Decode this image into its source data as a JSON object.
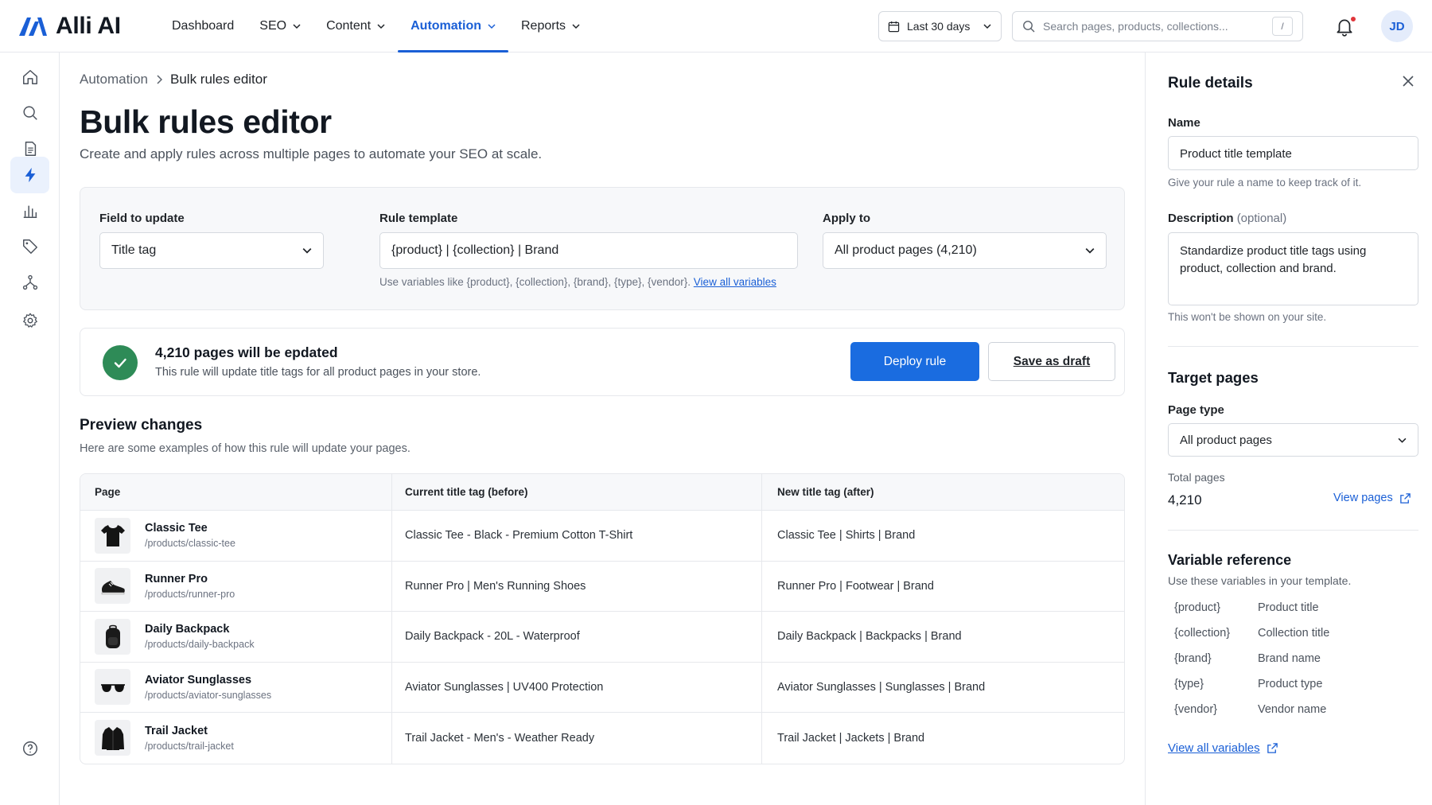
{
  "app": {
    "name": "Alli AI",
    "brand_color": "#1a5fd6"
  },
  "nav": [
    {
      "label": "Dashboard",
      "has_menu": false,
      "active": false
    },
    {
      "label": "SEO",
      "has_menu": true,
      "active": false
    },
    {
      "label": "Content",
      "has_menu": true,
      "active": false
    },
    {
      "label": "Automation",
      "has_menu": true,
      "active": true
    },
    {
      "label": "Reports",
      "has_menu": true,
      "active": false
    }
  ],
  "toolbar": {
    "date_range": "Last 30 days",
    "search_placeholder": "Search pages, products, collections...",
    "search_shortcut": "/",
    "avatar_initials": "JD"
  },
  "rail": [
    "home-icon",
    "search-icon",
    "document-icon",
    "lightning-icon",
    "bar-chart-icon",
    "tag-icon",
    "network-icon",
    "gear-icon",
    "help-icon"
  ],
  "breadcrumb": {
    "parent": "Automation",
    "current": "Bulk rules editor"
  },
  "page": {
    "title": "Bulk rules editor",
    "subtitle": "Create and apply rules across multiple pages to automate your SEO at scale."
  },
  "rule": {
    "field_label": "Field to update",
    "field_value": "Title tag",
    "template_label": "Rule template",
    "template_value": "{product} | {collection} | Brand",
    "template_hint": "Use variables like {product}, {collection}, {brand}, {type}, {vendor}.",
    "template_hint_link": "View all variables",
    "apply_label": "Apply to",
    "apply_value": "All product pages (4,210)"
  },
  "status": {
    "title": "4,210 pages will be epdated",
    "subtitle": "This rule will update title tags for all product pages in your store.",
    "deploy_label": "Deploy rule",
    "draft_label": "Save as draft",
    "status_color": "#2e8b57"
  },
  "preview": {
    "title": "Preview changes",
    "subtitle": "Here are some examples of how this rule will update your pages.",
    "columns": [
      "Page",
      "Current title tag (before)",
      "New title tag (after)"
    ],
    "rows": [
      {
        "name": "Classic Tee",
        "path": "/products/classic-tee",
        "before": "Classic Tee - Black - Premium Cotton T-Shirt",
        "after": "Classic Tee | Shirts | Brand",
        "thumb": "tshirt-icon"
      },
      {
        "name": "Runner Pro",
        "path": "/products/runner-pro",
        "before": "Runner Pro | Men's Running Shoes",
        "after": "Runner Pro | Footwear | Brand",
        "thumb": "shoe-icon"
      },
      {
        "name": "Daily Backpack",
        "path": "/products/daily-backpack",
        "before": "Daily Backpack - 20L - Waterproof",
        "after": "Daily Backpack | Backpacks | Brand",
        "thumb": "backpack-icon"
      },
      {
        "name": "Aviator Sunglasses",
        "path": "/products/aviator-sunglasses",
        "before": "Aviator Sunglasses | UV400 Protection",
        "after": "Aviator Sunglasses | Sunglasses | Brand",
        "thumb": "sunglasses-icon"
      },
      {
        "name": "Trail Jacket",
        "path": "/products/trail-jacket",
        "before": "Trail Jacket - Men's - Weather Ready",
        "after": "Trail Jacket | Jackets | Brand",
        "thumb": "jacket-icon"
      }
    ]
  },
  "panel": {
    "title": "Rule details",
    "name_label": "Name",
    "name_value": "Product title template",
    "name_hint": "Give your rule a name to keep track of it.",
    "desc_label": "Description",
    "desc_optional": "(optional)",
    "desc_value": "Standardize product title tags using product, collection and brand.",
    "desc_hint": "This won't be shown on your site.",
    "target_title": "Target pages",
    "page_type_label": "Page type",
    "page_type_value": "All product pages",
    "total_label": "Total pages",
    "total_value": "4,210",
    "view_pages": "View pages",
    "var_title": "Variable reference",
    "var_sub": "Use these variables in your template.",
    "variables": [
      {
        "key": "{product}",
        "desc": "Product title"
      },
      {
        "key": "{collection}",
        "desc": "Collection title"
      },
      {
        "key": "{brand}",
        "desc": "Brand name"
      },
      {
        "key": "{type}",
        "desc": "Product type"
      },
      {
        "key": "{vendor}",
        "desc": "Vendor name"
      }
    ],
    "view_all": "View all variables"
  }
}
